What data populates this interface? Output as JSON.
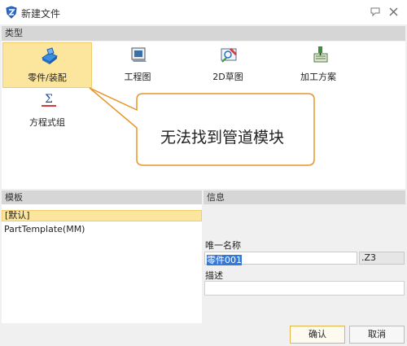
{
  "window": {
    "title": "新建文件",
    "app_icon": "shield-logo-icon",
    "titlebar_buttons": [
      "comment-icon",
      "close-icon"
    ]
  },
  "type_section": {
    "header": "类型",
    "items": [
      {
        "label": "零件/装配",
        "icon": "part-assembly-icon",
        "selected": true
      },
      {
        "label": "工程图",
        "icon": "drawing-icon",
        "selected": false
      },
      {
        "label": "2D草图",
        "icon": "sketch-2d-icon",
        "selected": false
      },
      {
        "label": "加工方案",
        "icon": "machining-plan-icon",
        "selected": false
      },
      {
        "label": "方程式组",
        "icon": "equation-set-icon",
        "selected": false
      }
    ]
  },
  "callout": {
    "text": "无法找到管道模块"
  },
  "template_section": {
    "header": "模板",
    "items": [
      {
        "label": "[默认]",
        "selected": true
      },
      {
        "label": "PartTemplate(MM)",
        "selected": false
      }
    ]
  },
  "info_section": {
    "header": "信息",
    "name_label": "唯一名称",
    "name_value": "零件001",
    "extension": ".Z3",
    "description_label": "描述",
    "description_value": ""
  },
  "buttons": {
    "ok": "确认",
    "cancel": "取消"
  },
  "colors": {
    "selection": "#fce59c",
    "callout_border": "#e8952a",
    "text_highlight": "#3478d8"
  }
}
